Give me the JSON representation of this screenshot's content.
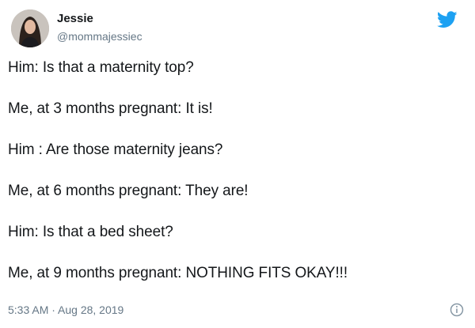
{
  "author": {
    "display_name": "Jessie",
    "handle": "@mommajessiec",
    "avatar_icon": "profile-photo"
  },
  "brand": {
    "icon": "twitter-bird-icon",
    "color": "#1da1f2"
  },
  "tweet": {
    "lines": [
      "Him: Is that a maternity top?",
      "Me, at 3 months pregnant: It is!",
      "Him : Are those maternity jeans?",
      "Me, at 6 months pregnant: They are!",
      "Him: Is that a bed sheet?",
      "Me, at 9 months pregnant: NOTHING FITS OKAY!!!"
    ],
    "timestamp": "5:33 AM · Aug 28, 2019"
  },
  "info_icon": "info-icon"
}
